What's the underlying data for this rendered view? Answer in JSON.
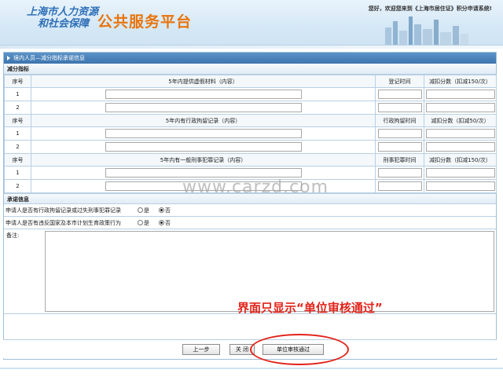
{
  "header": {
    "logo_line1": "上海市人力资源",
    "logo_line2": "和社会保障",
    "platform": "公共服务平台",
    "welcome": "您好，欢迎您来到《上海市居住证》积分申请系统!"
  },
  "panel_title": "境内人员—减分指标承诺信息",
  "deduction": {
    "section_title": "减分指标",
    "blocks": [
      {
        "seq_header": "序号",
        "content_header": "5年内提供虚假材料（内容）",
        "time_header": "登记时间",
        "score_header": "减扣分数（扣减150/次）",
        "rows": [
          "1",
          "2"
        ]
      },
      {
        "seq_header": "序号",
        "content_header": "5年内有行政拘留记录（内容）",
        "time_header": "行政拘留时间",
        "score_header": "减扣分数（扣减50/次）",
        "rows": [
          "1",
          "2"
        ]
      },
      {
        "seq_header": "序号",
        "content_header": "5年内有一般刑事犯罪记录（内容）",
        "time_header": "刑事犯罪时间",
        "score_header": "减扣分数（扣减150/次）",
        "rows": [
          "1",
          "2"
        ]
      }
    ]
  },
  "pledge": {
    "section_title": "承诺信息",
    "q1": "申请人是否有行政拘留记录或过失刑事犯罪记录",
    "q2": "申请人是否有违反国家及本市计划生育政策行为",
    "yes": "是",
    "no": "否"
  },
  "remarks_label": "备注:",
  "annotation": "界面只显示“单位审核通过”",
  "watermark": "www.carzd.com",
  "buttons": {
    "prev": "上一步",
    "close": "关 闭",
    "approve": "单位审核通过"
  },
  "colors": {
    "accent_blue": "#3c74ad",
    "platform_orange": "#e8740c",
    "annotation_red": "#e2231a"
  }
}
